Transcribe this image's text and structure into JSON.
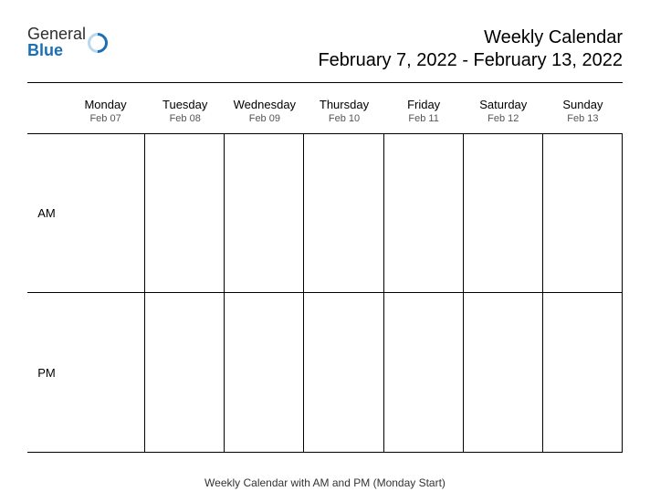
{
  "logo": {
    "line1": "General",
    "line2": "Blue"
  },
  "header": {
    "title": "Weekly Calendar",
    "date_range": "February 7, 2022 - February 13, 2022"
  },
  "days": [
    {
      "name": "Monday",
      "date": "Feb 07"
    },
    {
      "name": "Tuesday",
      "date": "Feb 08"
    },
    {
      "name": "Wednesday",
      "date": "Feb 09"
    },
    {
      "name": "Thursday",
      "date": "Feb 10"
    },
    {
      "name": "Friday",
      "date": "Feb 11"
    },
    {
      "name": "Saturday",
      "date": "Feb 12"
    },
    {
      "name": "Sunday",
      "date": "Feb 13"
    }
  ],
  "rows": [
    "AM",
    "PM"
  ],
  "footer": "Weekly Calendar with AM and PM (Monday Start)"
}
